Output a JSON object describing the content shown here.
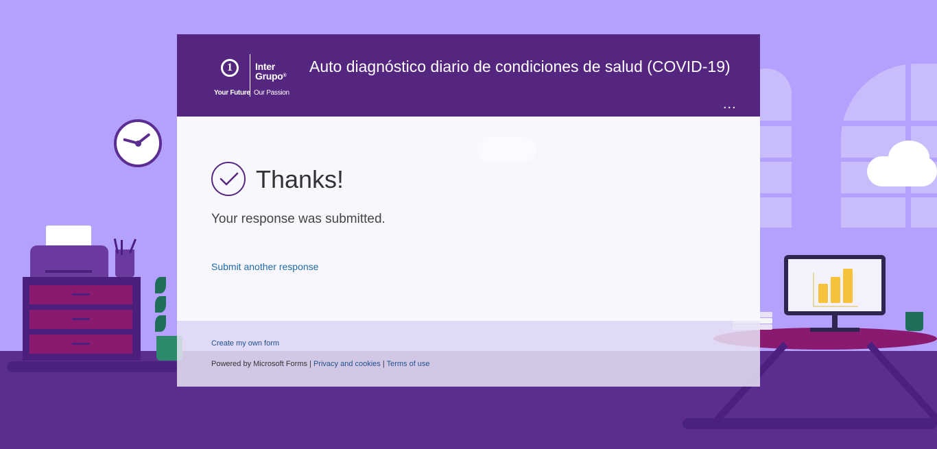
{
  "header": {
    "logo": {
      "brand_top": "Inter",
      "brand_bottom": "Grupo",
      "registered": "®",
      "tagline_left": "Your Future",
      "tagline_right": "Our Passion"
    },
    "title": "Auto diagnóstico diario de condiciones de salud (COVID-19)",
    "more_menu": "..."
  },
  "confirmation": {
    "heading": "Thanks!",
    "message": "Your response was submitted.",
    "submit_another": "Submit another response"
  },
  "footer": {
    "create_form": "Create my own form",
    "powered_by": "Powered by Microsoft Forms |",
    "privacy": "Privacy and cookies",
    "separator": "|",
    "terms": "Terms of use"
  },
  "colors": {
    "header_bg": "#55267f",
    "page_bg": "#b3a1fd",
    "link": "#1f6aa5"
  }
}
